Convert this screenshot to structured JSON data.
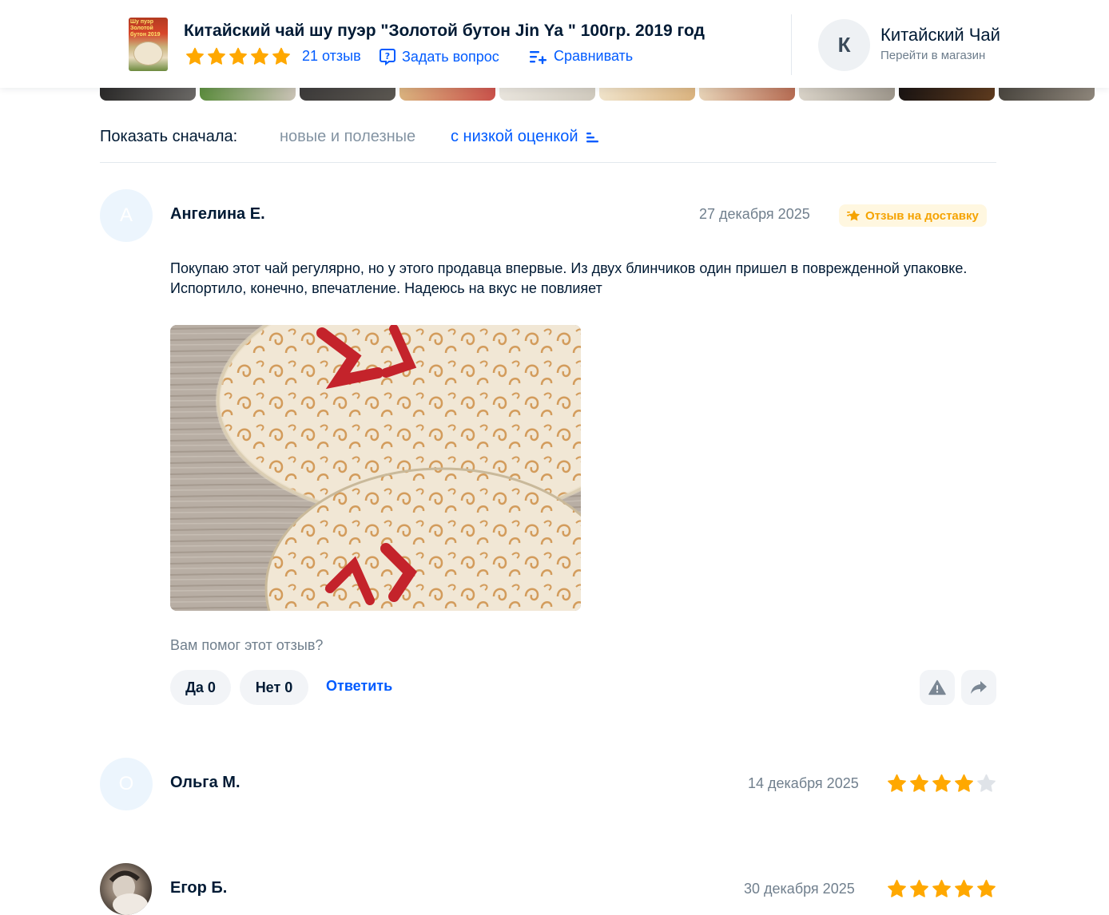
{
  "header": {
    "product_title": "Китайский чай шу пуэр \"Золотой бутон Jin Ya \" 100гр. 2019 год",
    "product_thumb_text": "Шу пуэр Золотой бутон 2019",
    "rating_stars": 5,
    "reviews_link": "21 отзыв",
    "ask_question": "Задать вопрос",
    "compare": "Сравнивать",
    "shop_initial": "К",
    "shop_name": "Китайский Чай",
    "shop_link": "Перейти в магазин"
  },
  "sort": {
    "label": "Показать сначала:",
    "option_helpful": "новые и полезные",
    "option_low": "с низкой оценкой"
  },
  "reviews": [
    {
      "initial": "А",
      "author": "Ангелина Е.",
      "date": "27 декабря 2025",
      "badge": "Отзыв на доставку",
      "text": "Покупаю этот чай регулярно, но у этого продавца впервые. Из двух блинчиков один пришел в поврежденной упаковке. Испортило, конечно, впечатление. Надеюсь на вкус не повлияет",
      "helpful_question": "Вам помог этот отзыв?",
      "yes": "Да 0",
      "no": "Нет 0",
      "reply": "Ответить"
    },
    {
      "initial": "О",
      "author": "Ольга М.",
      "date": "14 декабря 2025",
      "rating": 4
    },
    {
      "author": "Егор Б.",
      "date": "30 декабря 2025",
      "rating": 5
    }
  ],
  "colors": {
    "accent": "#005bff",
    "star": "#ffa800",
    "star_empty": "#dfe3e8",
    "badge_bg": "#fff7e0",
    "badge_text": "#f5a300"
  }
}
